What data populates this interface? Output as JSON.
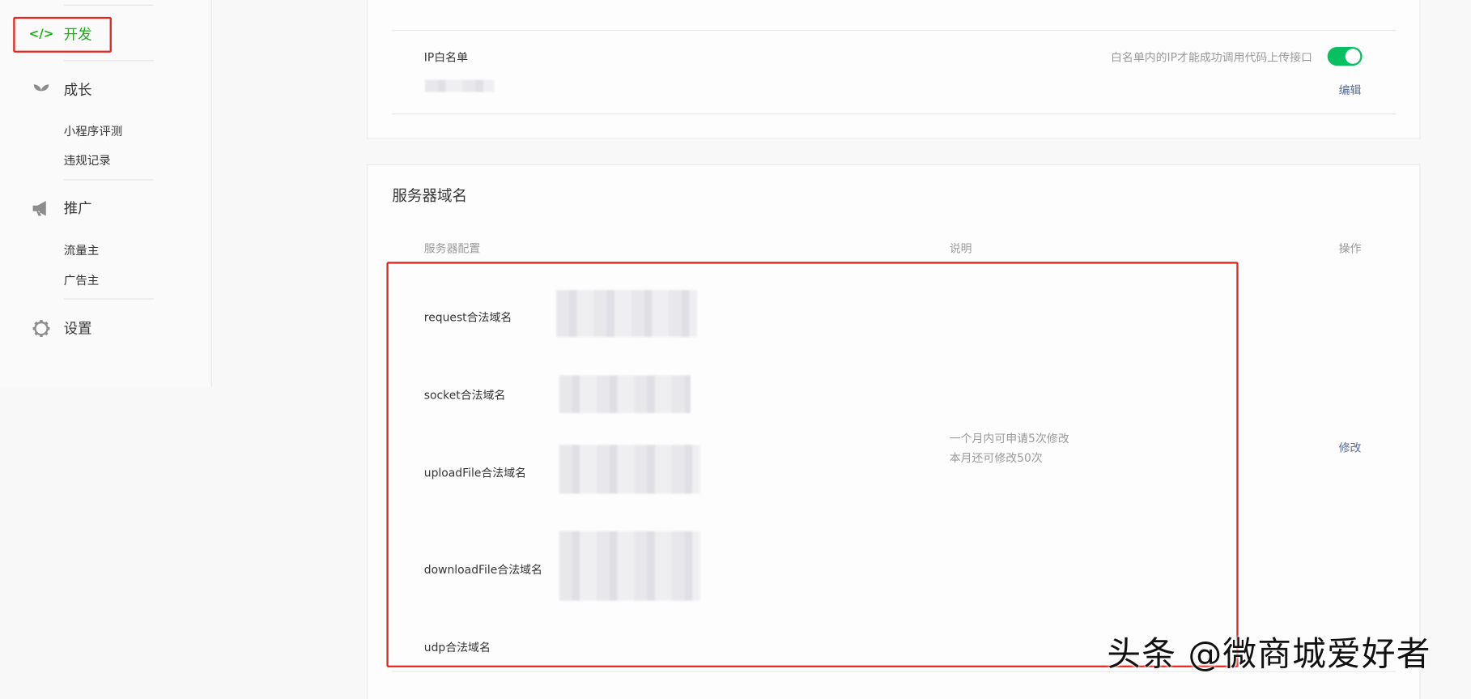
{
  "sidebar": {
    "dev": {
      "label": "开发",
      "icon": "code-icon"
    },
    "growth": {
      "label": "成长",
      "icon": "sprout-icon",
      "items": [
        "小程序评测",
        "违规记录"
      ]
    },
    "promo": {
      "label": "推广",
      "icon": "megaphone-icon",
      "items": [
        "流量主",
        "广告主"
      ]
    },
    "settings": {
      "label": "设置",
      "icon": "gear-icon"
    }
  },
  "ip_whitelist": {
    "label": "IP白名单",
    "hint": "白名单内的IP才能成功调用代码上传接口",
    "toggle_on": true,
    "edit_label": "编辑"
  },
  "server_domains": {
    "title": "服务器域名",
    "columns": [
      "服务器配置",
      "说明",
      "操作"
    ],
    "rows": [
      "request合法域名",
      "socket合法域名",
      "uploadFile合法域名",
      "downloadFile合法域名",
      "udp合法域名"
    ],
    "description": [
      "一个月内可申请5次修改",
      "本月还可修改50次"
    ],
    "action_label": "修改"
  },
  "watermark": "头条 @微商城爱好者",
  "colors": {
    "accent": "#1aad19",
    "toggle": "#07c160",
    "link": "#576b95",
    "highlight": "#e8251d"
  }
}
